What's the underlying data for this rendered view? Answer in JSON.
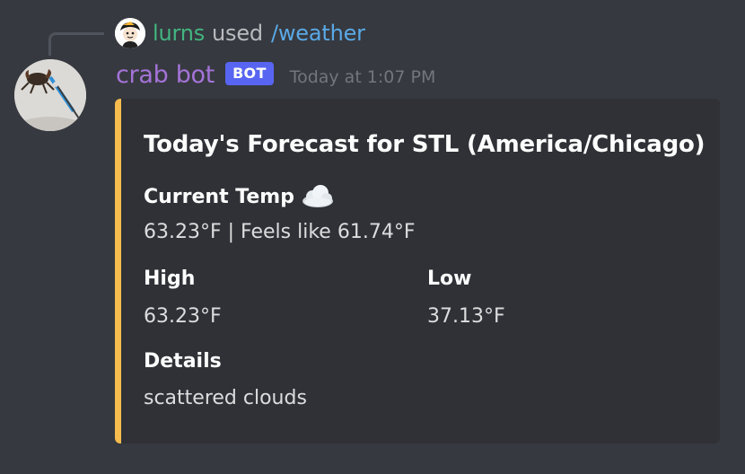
{
  "reply": {
    "username": "lurns",
    "used_text": "used",
    "command": "/weather"
  },
  "message": {
    "username": "crab bot",
    "bot_tag": "BOT",
    "timestamp": "Today at 1:07 PM"
  },
  "embed": {
    "accent_color": "#f7bc4e",
    "title": "Today's Forecast for STL (America/Chicago)",
    "fields": {
      "current_temp": {
        "name": "Current Temp",
        "icon": "cloud-icon",
        "value": "63.23°F | Feels like 61.74°F"
      },
      "high": {
        "name": "High",
        "value": "63.23°F"
      },
      "low": {
        "name": "Low",
        "value": "37.13°F"
      },
      "details": {
        "name": "Details",
        "value": "scattered clouds"
      }
    }
  },
  "colors": {
    "background": "#36393f",
    "embed_background": "#2f3136",
    "reply_username": "#43b581",
    "bot_username": "#a473d8",
    "bot_tag": "#5865f2",
    "command": "#5aa9e6"
  }
}
